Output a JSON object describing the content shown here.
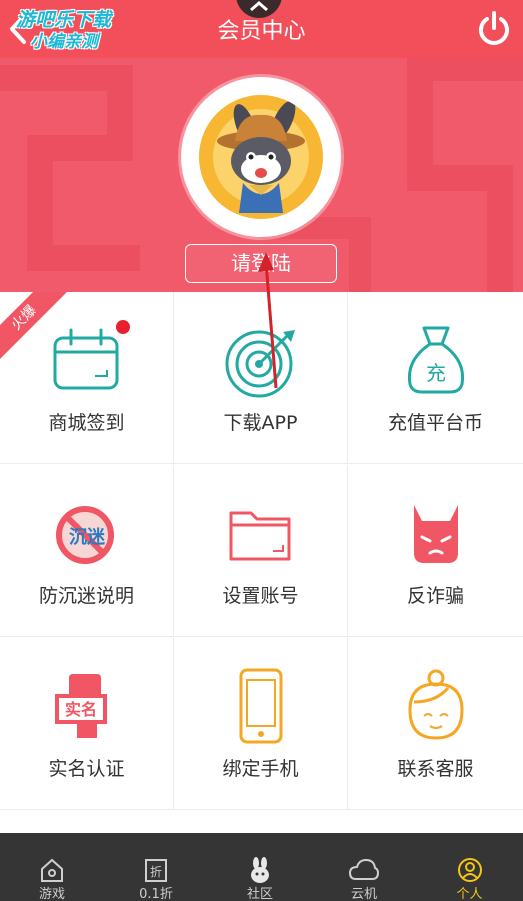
{
  "header": {
    "title": "会员中心",
    "watermark_line1": "游吧乐下载",
    "watermark_line2": "小编亲测",
    "back_icon": "chevron-left-icon",
    "power_icon": "power-icon"
  },
  "profile": {
    "login_label": "请登陆",
    "avatar": "rabbit-cowboy-avatar"
  },
  "ribbon": {
    "label": "火爆"
  },
  "grid": {
    "items": [
      {
        "label": "商城签到",
        "icon": "calendar-icon"
      },
      {
        "label": "下载APP",
        "icon": "target-icon"
      },
      {
        "label": "充值平台币",
        "icon": "money-bag-icon",
        "icon_text": "充"
      },
      {
        "label": "防沉迷说明",
        "icon": "no-addiction-icon",
        "icon_text": "沉迷"
      },
      {
        "label": "设置账号",
        "icon": "folder-icon"
      },
      {
        "label": "反诈骗",
        "icon": "devil-icon"
      },
      {
        "label": "实名认证",
        "icon": "id-card-icon",
        "icon_text": "实名"
      },
      {
        "label": "绑定手机",
        "icon": "phone-icon"
      },
      {
        "label": "联系客服",
        "icon": "support-agent-icon"
      }
    ]
  },
  "nav": {
    "items": [
      {
        "label": "游戏",
        "icon": "home-icon",
        "icon_text": ""
      },
      {
        "label": "0.1折",
        "icon": "discount-icon",
        "icon_text": "折"
      },
      {
        "label": "社区",
        "icon": "rabbit-icon",
        "icon_text": ""
      },
      {
        "label": "云机",
        "icon": "cloud-icon",
        "icon_text": ""
      },
      {
        "label": "个人",
        "icon": "user-icon",
        "icon_text": ""
      }
    ],
    "active_index": 4
  },
  "colors": {
    "brand_red": "#f24f5a",
    "teal": "#23a9a3",
    "pink": "#f05663",
    "orange": "#f5a623",
    "nav_active": "#f5c518"
  }
}
